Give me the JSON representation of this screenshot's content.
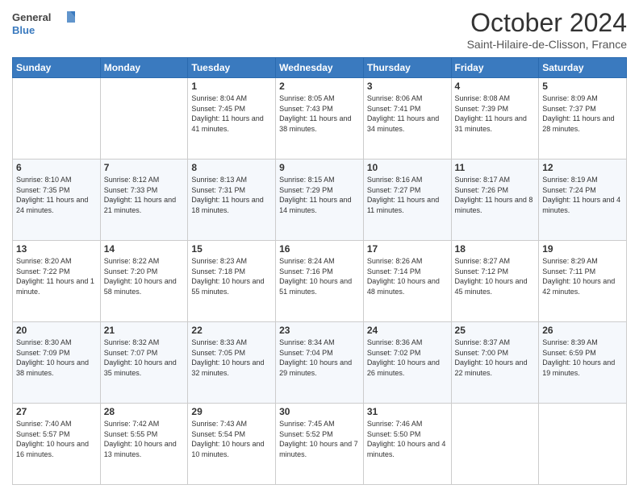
{
  "header": {
    "logo_line1": "General",
    "logo_line2": "Blue",
    "month_title": "October 2024",
    "subtitle": "Saint-Hilaire-de-Clisson, France"
  },
  "weekdays": [
    "Sunday",
    "Monday",
    "Tuesday",
    "Wednesday",
    "Thursday",
    "Friday",
    "Saturday"
  ],
  "weeks": [
    [
      {
        "day": "",
        "info": ""
      },
      {
        "day": "",
        "info": ""
      },
      {
        "day": "1",
        "info": "Sunrise: 8:04 AM\nSunset: 7:45 PM\nDaylight: 11 hours and 41 minutes."
      },
      {
        "day": "2",
        "info": "Sunrise: 8:05 AM\nSunset: 7:43 PM\nDaylight: 11 hours and 38 minutes."
      },
      {
        "day": "3",
        "info": "Sunrise: 8:06 AM\nSunset: 7:41 PM\nDaylight: 11 hours and 34 minutes."
      },
      {
        "day": "4",
        "info": "Sunrise: 8:08 AM\nSunset: 7:39 PM\nDaylight: 11 hours and 31 minutes."
      },
      {
        "day": "5",
        "info": "Sunrise: 8:09 AM\nSunset: 7:37 PM\nDaylight: 11 hours and 28 minutes."
      }
    ],
    [
      {
        "day": "6",
        "info": "Sunrise: 8:10 AM\nSunset: 7:35 PM\nDaylight: 11 hours and 24 minutes."
      },
      {
        "day": "7",
        "info": "Sunrise: 8:12 AM\nSunset: 7:33 PM\nDaylight: 11 hours and 21 minutes."
      },
      {
        "day": "8",
        "info": "Sunrise: 8:13 AM\nSunset: 7:31 PM\nDaylight: 11 hours and 18 minutes."
      },
      {
        "day": "9",
        "info": "Sunrise: 8:15 AM\nSunset: 7:29 PM\nDaylight: 11 hours and 14 minutes."
      },
      {
        "day": "10",
        "info": "Sunrise: 8:16 AM\nSunset: 7:27 PM\nDaylight: 11 hours and 11 minutes."
      },
      {
        "day": "11",
        "info": "Sunrise: 8:17 AM\nSunset: 7:26 PM\nDaylight: 11 hours and 8 minutes."
      },
      {
        "day": "12",
        "info": "Sunrise: 8:19 AM\nSunset: 7:24 PM\nDaylight: 11 hours and 4 minutes."
      }
    ],
    [
      {
        "day": "13",
        "info": "Sunrise: 8:20 AM\nSunset: 7:22 PM\nDaylight: 11 hours and 1 minute."
      },
      {
        "day": "14",
        "info": "Sunrise: 8:22 AM\nSunset: 7:20 PM\nDaylight: 10 hours and 58 minutes."
      },
      {
        "day": "15",
        "info": "Sunrise: 8:23 AM\nSunset: 7:18 PM\nDaylight: 10 hours and 55 minutes."
      },
      {
        "day": "16",
        "info": "Sunrise: 8:24 AM\nSunset: 7:16 PM\nDaylight: 10 hours and 51 minutes."
      },
      {
        "day": "17",
        "info": "Sunrise: 8:26 AM\nSunset: 7:14 PM\nDaylight: 10 hours and 48 minutes."
      },
      {
        "day": "18",
        "info": "Sunrise: 8:27 AM\nSunset: 7:12 PM\nDaylight: 10 hours and 45 minutes."
      },
      {
        "day": "19",
        "info": "Sunrise: 8:29 AM\nSunset: 7:11 PM\nDaylight: 10 hours and 42 minutes."
      }
    ],
    [
      {
        "day": "20",
        "info": "Sunrise: 8:30 AM\nSunset: 7:09 PM\nDaylight: 10 hours and 38 minutes."
      },
      {
        "day": "21",
        "info": "Sunrise: 8:32 AM\nSunset: 7:07 PM\nDaylight: 10 hours and 35 minutes."
      },
      {
        "day": "22",
        "info": "Sunrise: 8:33 AM\nSunset: 7:05 PM\nDaylight: 10 hours and 32 minutes."
      },
      {
        "day": "23",
        "info": "Sunrise: 8:34 AM\nSunset: 7:04 PM\nDaylight: 10 hours and 29 minutes."
      },
      {
        "day": "24",
        "info": "Sunrise: 8:36 AM\nSunset: 7:02 PM\nDaylight: 10 hours and 26 minutes."
      },
      {
        "day": "25",
        "info": "Sunrise: 8:37 AM\nSunset: 7:00 PM\nDaylight: 10 hours and 22 minutes."
      },
      {
        "day": "26",
        "info": "Sunrise: 8:39 AM\nSunset: 6:59 PM\nDaylight: 10 hours and 19 minutes."
      }
    ],
    [
      {
        "day": "27",
        "info": "Sunrise: 7:40 AM\nSunset: 5:57 PM\nDaylight: 10 hours and 16 minutes."
      },
      {
        "day": "28",
        "info": "Sunrise: 7:42 AM\nSunset: 5:55 PM\nDaylight: 10 hours and 13 minutes."
      },
      {
        "day": "29",
        "info": "Sunrise: 7:43 AM\nSunset: 5:54 PM\nDaylight: 10 hours and 10 minutes."
      },
      {
        "day": "30",
        "info": "Sunrise: 7:45 AM\nSunset: 5:52 PM\nDaylight: 10 hours and 7 minutes."
      },
      {
        "day": "31",
        "info": "Sunrise: 7:46 AM\nSunset: 5:50 PM\nDaylight: 10 hours and 4 minutes."
      },
      {
        "day": "",
        "info": ""
      },
      {
        "day": "",
        "info": ""
      }
    ]
  ]
}
